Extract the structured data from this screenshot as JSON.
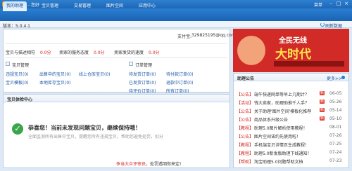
{
  "app": {
    "title": "淘宝助理 - 您好",
    "menu": "菜单",
    "refresh": "刷新数据",
    "version": "版本：5.0.4.1"
  },
  "nav": {
    "tabs": [
      "我的助理",
      "宝贝管理",
      "交易管理",
      "图片空间",
      "应用中心"
    ]
  },
  "account": {
    "alipay_label": "支付宝:",
    "alipay_value": "329825195@qq.com"
  },
  "ratings": [
    {
      "label": "宝贝与描述相符",
      "value": "0.0分"
    },
    {
      "label": "卖家的服务态度",
      "value": "0.0分"
    },
    {
      "label": "卖家发货的速度",
      "value": "0.0分"
    }
  ],
  "product": {
    "title": "宝贝管理",
    "links": [
      [
        "违规宝贝(0)",
        "出售中的宝贝(0)",
        "线上仓库宝贝(0)"
      ],
      [
        "宝贝模板(0)",
        "本地库存宝贝(0)",
        ""
      ]
    ]
  },
  "order": {
    "title": "订单管理",
    "links": [
      [
        "待发货订单(0)",
        "待付款订单(0)"
      ],
      [
        "已发货订单(0)",
        "退款中订单(0)"
      ],
      [
        "待评价订单(0)",
        "所有订单(0)"
      ]
    ]
  },
  "health": {
    "title": "宝贝体检中心",
    "headline": "恭喜您！当前未发现问题宝贝，继续保持哦！",
    "desc": "全面监测所有出售中宝贝，提醒您所有违规宝贝，帮助您避免处罚，扣分",
    "bottom_highlight": "争当大众评审员，",
    "bottom_rest": "处罚透明你来定!"
  },
  "banner": {
    "big": "全民无线",
    "sub": "大时代"
  },
  "notices": {
    "title": "助理公告",
    "more": "更多>>",
    "items": [
      {
        "tag": "【公告】",
        "text": "端午快递网单等早上几期计？",
        "hot": true,
        "date": "06-05"
      },
      {
        "tag": "【活动】",
        "text": "钱大卖家，助理助推千人手？",
        "hot": true,
        "date": "05-26"
      },
      {
        "tag": "【公告】",
        "text": "关于助理'图片空间'模板化推荐",
        "hot": true,
        "date": "05-14"
      },
      {
        "tag": "【公告】",
        "text": "商品体系升级公告",
        "hot": true,
        "date": "05-10"
      },
      {
        "tag": "【教程】",
        "text": "助理5.0图片解析使用教程！",
        "hot": false,
        "date": "08-01"
      },
      {
        "tag": "【公告】",
        "text": "图片空间诺约先使用啦！",
        "hot": false,
        "date": "07-26"
      },
      {
        "tag": "【教程】",
        "text": "手机端宝贝详情页生成教程！",
        "hot": false,
        "date": "07-25"
      },
      {
        "tag": "【教程】",
        "text": "助理5.0新发版助理下线通知！",
        "hot": false,
        "date": "07-24"
      },
      {
        "tag": "【帮助】",
        "text": "淘宝助理5.0问题帮助文档",
        "hot": false,
        "date": "07-23"
      }
    ]
  },
  "colors": {
    "nav_blue": "#1f67b6",
    "accent_red": "#d0241c",
    "ok_green": "#3aa64a"
  }
}
